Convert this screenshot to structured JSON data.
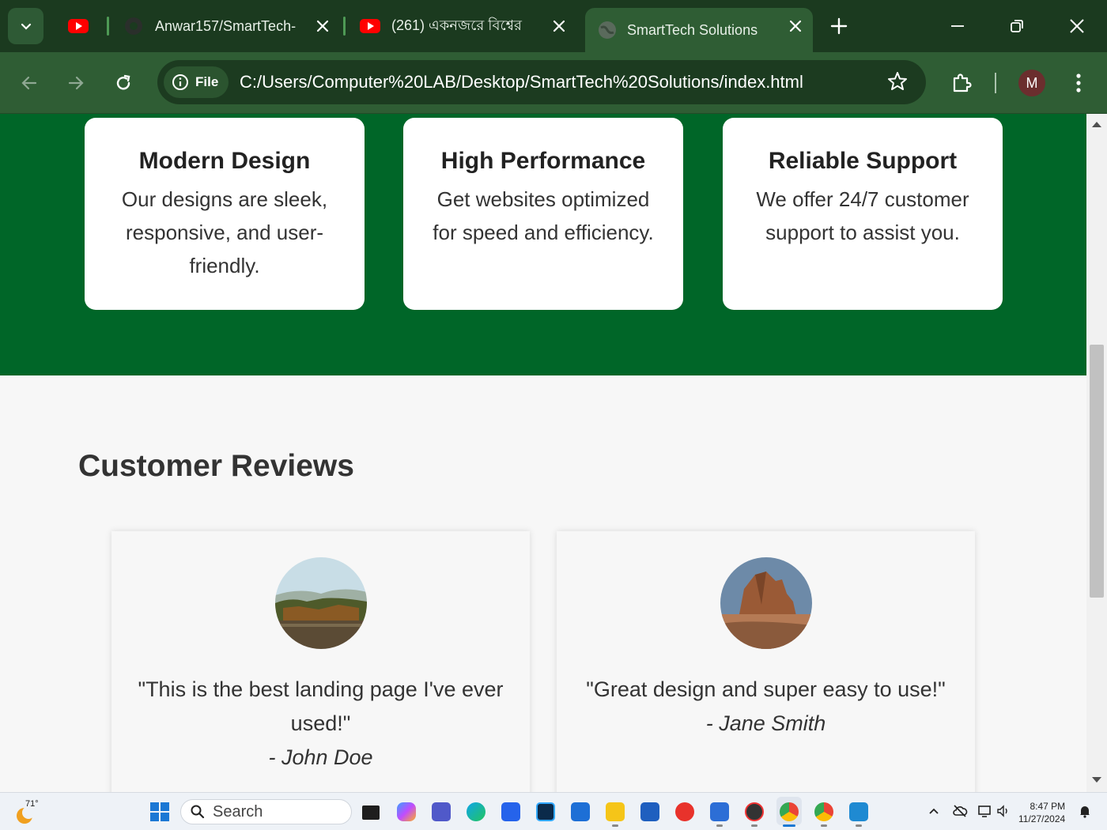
{
  "browser": {
    "tabs": [
      {
        "title": "",
        "icon": "youtube-icon"
      },
      {
        "title": "Anwar157/SmartTech-",
        "icon": "github-icon"
      },
      {
        "title": "(261) একনজরে বিশ্বের",
        "icon": "youtube-icon"
      },
      {
        "title": "SmartTech Solutions",
        "icon": "globe-icon",
        "active": true
      }
    ],
    "address": {
      "chip": "File",
      "url": "C:/Users/Computer%20LAB/Desktop/SmartTech%20Solutions/index.html"
    },
    "profile_initial": "M",
    "theme_color": "#2f5d34"
  },
  "features": {
    "background": "#006628",
    "cards": [
      {
        "title": "Modern Design",
        "text": "Our designs are sleek, responsive, and user-friendly."
      },
      {
        "title": "High Performance",
        "text": "Get websites optimized for speed and efficiency."
      },
      {
        "title": "Reliable Support",
        "text": "We offer 24/7 customer support to assist you."
      }
    ]
  },
  "reviews": {
    "title": "Customer Reviews",
    "items": [
      {
        "quote": "\"This is the best landing page I've ever used!\"",
        "author": "- John Doe",
        "image": "lake-landscape"
      },
      {
        "quote": "\"Great design and super easy to use!\"",
        "author": "- Jane Smith",
        "image": "desert-rock"
      }
    ]
  },
  "taskbar": {
    "weather": "71°",
    "search_placeholder": "Search",
    "time": "8:47 PM",
    "date": "11/27/2024"
  }
}
